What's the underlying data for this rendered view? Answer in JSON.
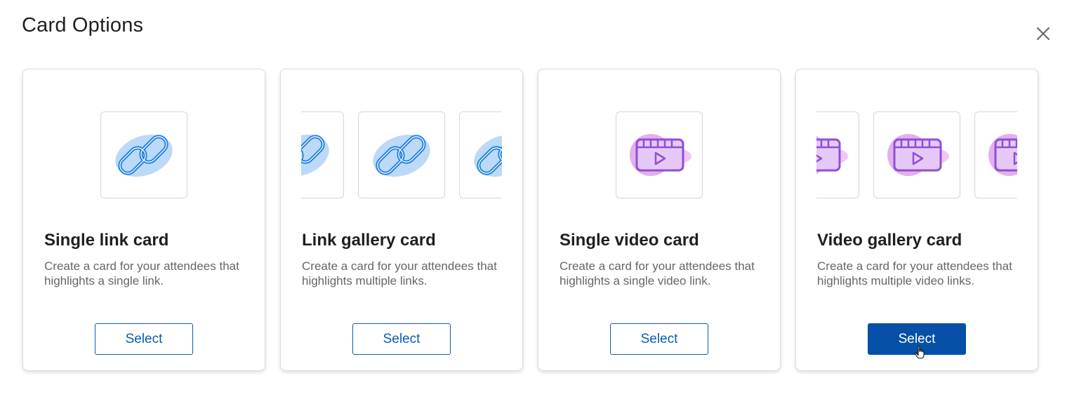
{
  "dialog": {
    "title": "Card Options",
    "close_icon": "close-icon"
  },
  "cards": [
    {
      "title": "Single link card",
      "description": "Create a card for your attendees that highlights a single link.",
      "button_label": "Select",
      "icon": "link-icon",
      "state": "default"
    },
    {
      "title": "Link gallery card",
      "description": "Create a card for your attendees that highlights multiple links.",
      "button_label": "Select",
      "icon": "link-icon",
      "state": "default"
    },
    {
      "title": "Single video card",
      "description": "Create a card for your attendees that highlights a single video link.",
      "button_label": "Select",
      "icon": "video-icon",
      "state": "default"
    },
    {
      "title": "Video gallery card",
      "description": "Create a card for your attendees that highlights multiple video links.",
      "button_label": "Select",
      "icon": "video-icon",
      "state": "hover"
    }
  ],
  "colors": {
    "primary": "#0a5bb5",
    "primary_active": "#0650a8",
    "link_icon": "#1b7fe0",
    "link_blob": "#bcd9f7",
    "video_icon": "#8e4fd6",
    "video_blob": "#e5b8ef"
  }
}
